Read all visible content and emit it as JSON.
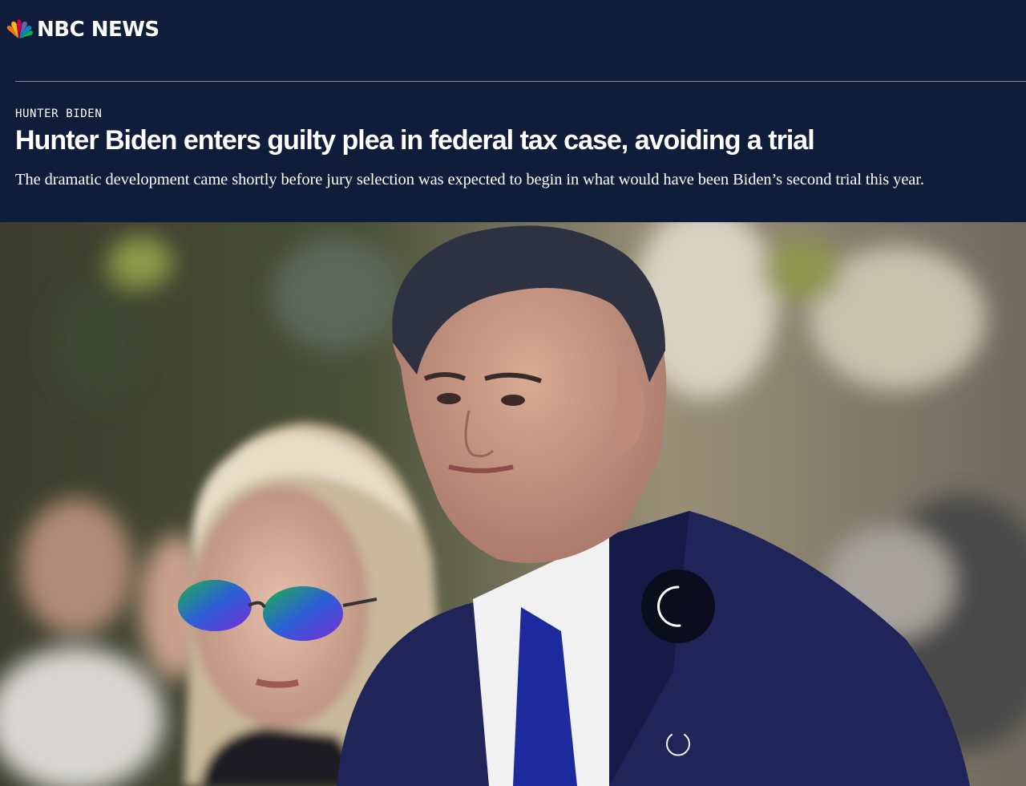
{
  "brand": {
    "logo_text": "NBC NEWS",
    "logo_icon": "nbc-peacock-icon",
    "colors": {
      "header_bg": "#0f1d3a",
      "text": "#ffffff",
      "rule": "#7f8aa0"
    }
  },
  "article": {
    "eyebrow": "HUNTER BIDEN",
    "headline": "Hunter Biden enters guilty plea in federal tax case, avoiding a trial",
    "dek": "The dramatic development came shortly before jury selection was expected to begin in what would have been Biden’s second trial this year."
  },
  "video": {
    "state": "loading",
    "spinner_icon": "loading-spinner-icon"
  }
}
